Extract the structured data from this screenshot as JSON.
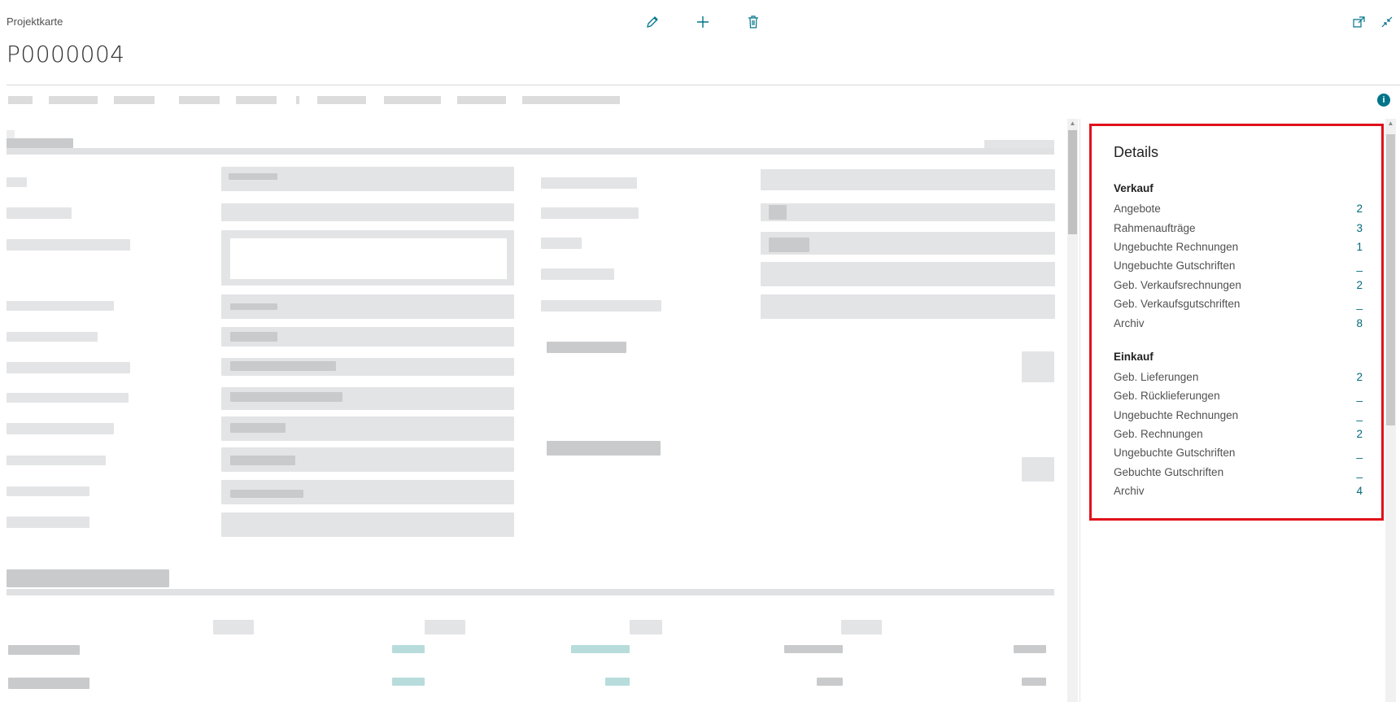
{
  "header": {
    "caption": "Projektkarte",
    "title": "P0000004"
  },
  "toolbar": {
    "edit_icon": "pencil-icon",
    "new_icon": "plus-icon",
    "delete_icon": "trash-icon",
    "popout_icon": "open-in-new-window-icon",
    "collapse_icon": "collapse-icon",
    "info_icon": "i"
  },
  "details": {
    "title": "Details",
    "sales": {
      "heading": "Verkauf",
      "items": [
        {
          "label": "Angebote",
          "value": "2"
        },
        {
          "label": "Rahmenaufträge",
          "value": "3"
        },
        {
          "label": "Ungebuchte Rechnungen",
          "value": "1"
        },
        {
          "label": "Ungebuchte Gutschriften",
          "value": "_"
        },
        {
          "label": "Geb. Verkaufsrechnungen",
          "value": "2"
        },
        {
          "label": "Geb. Verkaufsgutschriften",
          "value": "_"
        },
        {
          "label": "Archiv",
          "value": "8"
        }
      ]
    },
    "purchase": {
      "heading": "Einkauf",
      "items": [
        {
          "label": "Geb. Lieferungen",
          "value": "2"
        },
        {
          "label": "Geb. Rücklieferungen",
          "value": "_"
        },
        {
          "label": "Ungebuchte Rechnungen",
          "value": "_"
        },
        {
          "label": "Geb. Rechnungen",
          "value": "2"
        },
        {
          "label": "Ungebuchte Gutschriften",
          "value": "_"
        },
        {
          "label": "Gebuchte Gutschriften",
          "value": "_"
        },
        {
          "label": "Archiv",
          "value": "4"
        }
      ]
    }
  },
  "colors": {
    "accent": "#00697a",
    "highlight_border": "#e0101a"
  }
}
